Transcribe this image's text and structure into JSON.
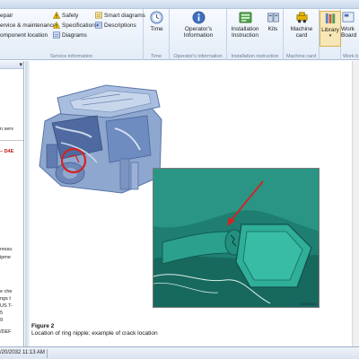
{
  "ribbon": {
    "service_information": {
      "items": [
        {
          "label": "epair",
          "icon": "wrench-icon"
        },
        {
          "label": "ervice & maintenance",
          "icon": "maintenance-icon"
        },
        {
          "label": "omponent location",
          "icon": "component-icon"
        },
        {
          "label": "Safety",
          "icon": "warning-icon"
        },
        {
          "label": "Specifications",
          "icon": "specifications-icon"
        },
        {
          "label": "Diagrams",
          "icon": "diagrams-icon"
        },
        {
          "label": "Smart diagrams",
          "icon": "smart-diagrams-icon"
        },
        {
          "label": "Descriptions",
          "icon": "descriptions-icon"
        }
      ],
      "group_label": "Service information"
    },
    "time": {
      "button": "Time",
      "group_label": "Time",
      "icon": "clock-icon"
    },
    "operators": {
      "button_line1": "Operator's",
      "button_line2": "Information",
      "group_label": "Operator's information",
      "icon": "operator-info-icon"
    },
    "installation": {
      "button1_line1": "Installation",
      "button1_line2": "Instruction",
      "button2": "Kits",
      "group_label": "Installation instruction",
      "icons": [
        "installation-icon",
        "kits-icon"
      ]
    },
    "machine_card": {
      "button_line1": "Machine",
      "button_line2": "card",
      "group_label": "Machine card",
      "icon": "machine-card-icon"
    },
    "library": {
      "button": "Library",
      "icon": "library-icon"
    },
    "work": {
      "button_line1": "Work",
      "button_line2": "Board",
      "group_label": "Work b",
      "icon": "work-board-icon"
    }
  },
  "left_pane": {
    "lines": [
      {
        "text": "n serv",
        "style": "normal"
      },
      {
        "text": "– D4E",
        "style": "red"
      },
      {
        "text": "ressu",
        "style": "normal"
      },
      {
        "text": "ipme",
        "style": "normal"
      },
      {
        "text": "e che",
        "style": "normal"
      },
      {
        "text": "ngs t",
        "style": "normal"
      },
      {
        "text": "US T-",
        "style": "normal"
      },
      {
        "text": "5",
        "style": "normal"
      },
      {
        "text": "9",
        "style": "normal"
      },
      {
        "text": "/DEF",
        "style": "normal"
      }
    ]
  },
  "content": {
    "photo_id": "V1231641",
    "figure_title": "Figure 2",
    "figure_caption": "Location of ring nipple; example of crack location"
  },
  "status": {
    "datetime": "/20/2032 11:13 AM"
  },
  "colors": {
    "engine_blue": "#8fa8cf",
    "engine_block": "#5f7fb4",
    "highlight_red": "#d42323",
    "photo_teal": "#1d8a7a"
  }
}
